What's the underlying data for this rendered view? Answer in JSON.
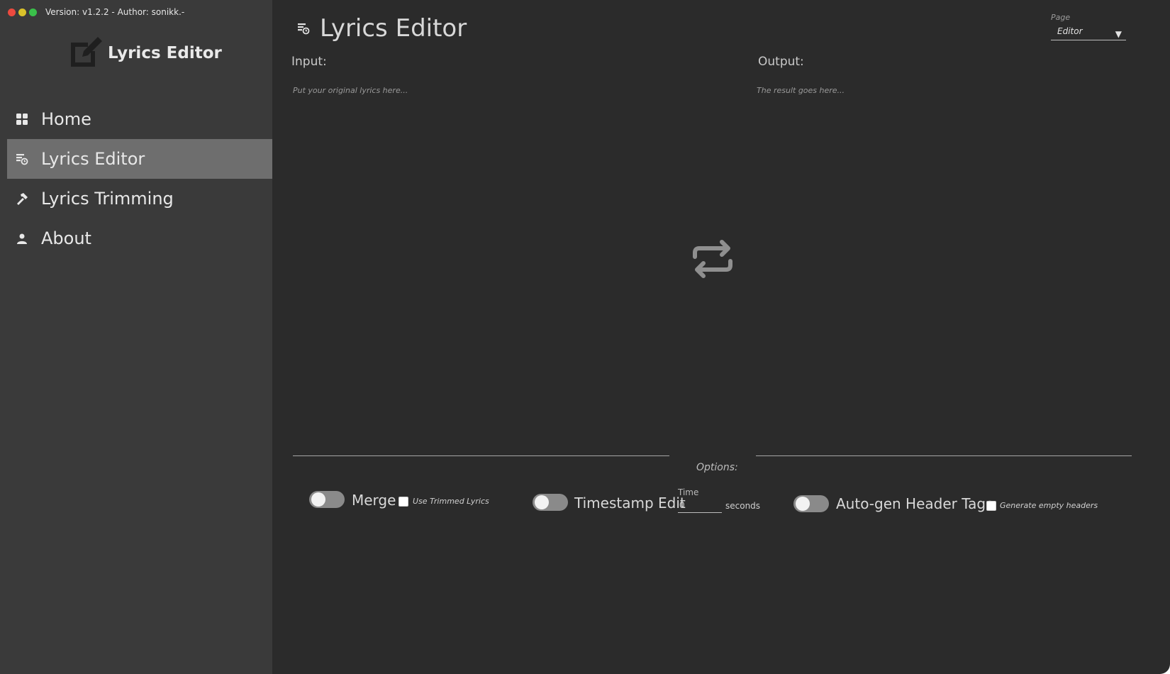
{
  "titlebar": {
    "version_text": "Version: v1.2.2 - Author: sonikk.-"
  },
  "brand": {
    "title": "Lyrics Editor",
    "icon": "edit-square-icon"
  },
  "sidebar": {
    "items": [
      {
        "label": "Home",
        "icon": "grid-icon",
        "active": false
      },
      {
        "label": "Lyrics Editor",
        "icon": "lyrics-editor-icon",
        "active": true
      },
      {
        "label": "Lyrics Trimming",
        "icon": "hammer-icon",
        "active": false
      },
      {
        "label": "About",
        "icon": "person-icon",
        "active": false
      }
    ]
  },
  "main": {
    "title": "Lyrics Editor",
    "page_select": {
      "label": "Page",
      "value": "Editor"
    },
    "input": {
      "label": "Input:",
      "placeholder": "Put your original lyrics here...",
      "value": ""
    },
    "output": {
      "label": "Output:",
      "placeholder": "The result goes here...",
      "value": ""
    },
    "options": {
      "label": "Options:",
      "merge": {
        "label": "Merge",
        "enabled": false,
        "checkbox_label": "Use Trimmed Lyrics",
        "checkbox_checked": false
      },
      "timestamp": {
        "label": "Timestamp Edit",
        "enabled": false,
        "time_label": "Time",
        "time_value": "0",
        "unit": "seconds"
      },
      "header_tags": {
        "label": "Auto-gen Header Tags",
        "enabled": false,
        "checkbox_label": "Generate empty headers",
        "checkbox_checked": false
      }
    }
  },
  "colors": {
    "window_bg": "#2b2b2b",
    "sidebar_bg": "#3a3a3a",
    "active_item_bg": "#6e6e6e",
    "traffic_red": "#ec4a3f",
    "traffic_yellow": "#d9c12a",
    "traffic_green": "#3ac04a"
  }
}
